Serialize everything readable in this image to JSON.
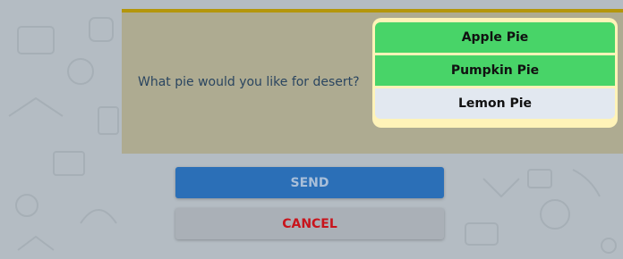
{
  "question": {
    "text": "What pie would you like for desert?"
  },
  "options": [
    {
      "label": "Apple Pie",
      "selected": true
    },
    {
      "label": "Pumpkin Pie",
      "selected": true
    },
    {
      "label": "Lemon Pie",
      "selected": false
    }
  ],
  "actions": {
    "send_label": "SEND",
    "cancel_label": "CANCEL"
  },
  "colors": {
    "panel_bg": "#aeab91",
    "panel_border": "#b4960c",
    "options_frame": "#fff3b8",
    "selected": "#48d468",
    "unselected": "#e2e8f0",
    "send_bg": "#2b6fb7",
    "cancel_text": "#c8141c"
  }
}
